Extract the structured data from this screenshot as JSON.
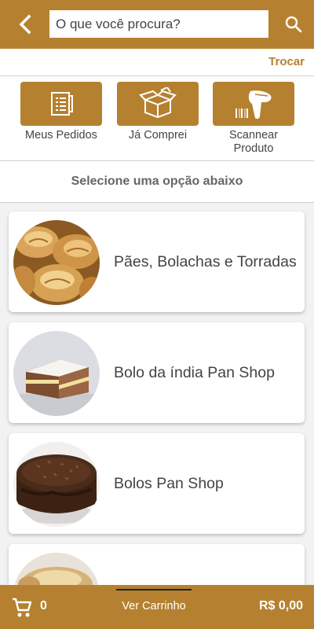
{
  "search": {
    "placeholder": "O que você procura?"
  },
  "header": {
    "trocar_label": "Trocar"
  },
  "actions": [
    {
      "label": "Meus Pedidos",
      "icon": "receipt-icon"
    },
    {
      "label": "Já Comprei",
      "icon": "open-box-icon"
    },
    {
      "label": "Scannear Produto",
      "icon": "barcode-scanner-icon"
    }
  ],
  "section_title": "Selecione uma opção abaixo",
  "categories": [
    {
      "label": "Pães, Bolachas e Torradas",
      "image": "bread-rolls-image"
    },
    {
      "label": "Bolo da índia Pan Shop",
      "image": "layer-cake-slice-image"
    },
    {
      "label": "Bolos Pan Shop",
      "image": "chocolate-cake-image"
    },
    {
      "label": "",
      "image": "pastry-image"
    }
  ],
  "bottom_bar": {
    "cart_count": "0",
    "view_cart_label": "Ver Carrinho",
    "total": "R$ 0,00"
  },
  "colors": {
    "brand": "#b58130",
    "background": "#f2f2f2"
  }
}
